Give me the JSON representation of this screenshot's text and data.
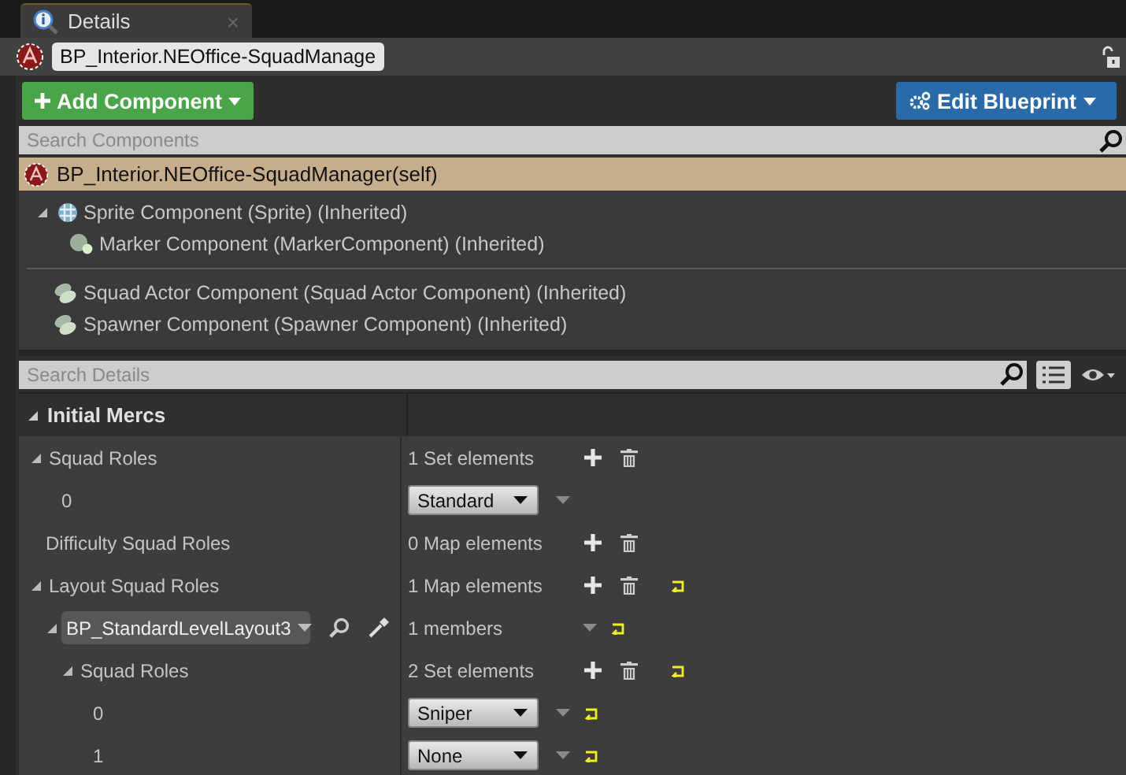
{
  "tab": {
    "title": "Details",
    "close": "×",
    "selected": true
  },
  "actor": {
    "name": "BP_Interior.NEOffice-SquadManage"
  },
  "toolbar": {
    "add_button": "Add Component",
    "edit_button": "Edit Blueprint"
  },
  "component_search": {
    "placeholder": "Search Components"
  },
  "root_component": {
    "label": "BP_Interior.NEOffice-SquadManager(self)",
    "selected": true
  },
  "component_groups": [
    {
      "items": [
        {
          "label": "Sprite Component (Sprite) (Inherited)",
          "kind": "sprite",
          "selected": false,
          "expanded": true,
          "children": [
            {
              "label": "Marker Component (MarkerComponent) (Inherited)",
              "kind": "marker",
              "selected": false
            }
          ]
        }
      ]
    },
    {
      "items": [
        {
          "label": "Squad Actor Component (Squad Actor Component) (Inherited)",
          "kind": "actor",
          "selected": false
        },
        {
          "label": "Spawner Component (Spawner Component) (Inherited)",
          "kind": "actor",
          "selected": false
        }
      ]
    }
  ],
  "details_search": {
    "placeholder": "Search Details"
  },
  "category": {
    "title": "Initial Mercs",
    "expanded": true,
    "rows": [
      {
        "name": "Squad Roles",
        "kind": "container",
        "value": "1 Set elements",
        "expanded": true,
        "reset_to_default": false,
        "children": [
          {
            "name": "0",
            "kind": "enum",
            "value": "Standard",
            "reset_to_default": false
          }
        ]
      },
      {
        "name": "Difficulty Squad Roles",
        "kind": "container",
        "value": "0 Map elements",
        "reset_to_default": false
      },
      {
        "name": "Layout Squad Roles",
        "kind": "container",
        "value": "1 Map elements",
        "expanded": true,
        "reset_to_default": true,
        "children": [
          {
            "name": "BP_StandardLevelLayout3",
            "kind": "object",
            "value": "1 members",
            "expanded": true,
            "reset_to_default": true,
            "children": [
              {
                "name": "Squad Roles",
                "kind": "container",
                "value": "2 Set elements",
                "expanded": true,
                "reset_to_default": true,
                "children": [
                  {
                    "name": "0",
                    "kind": "enum",
                    "value": "Sniper",
                    "reset_to_default": true
                  },
                  {
                    "name": "1",
                    "kind": "enum",
                    "value": "None",
                    "reset_to_default": true
                  }
                ]
              }
            ]
          }
        ]
      }
    ]
  }
}
